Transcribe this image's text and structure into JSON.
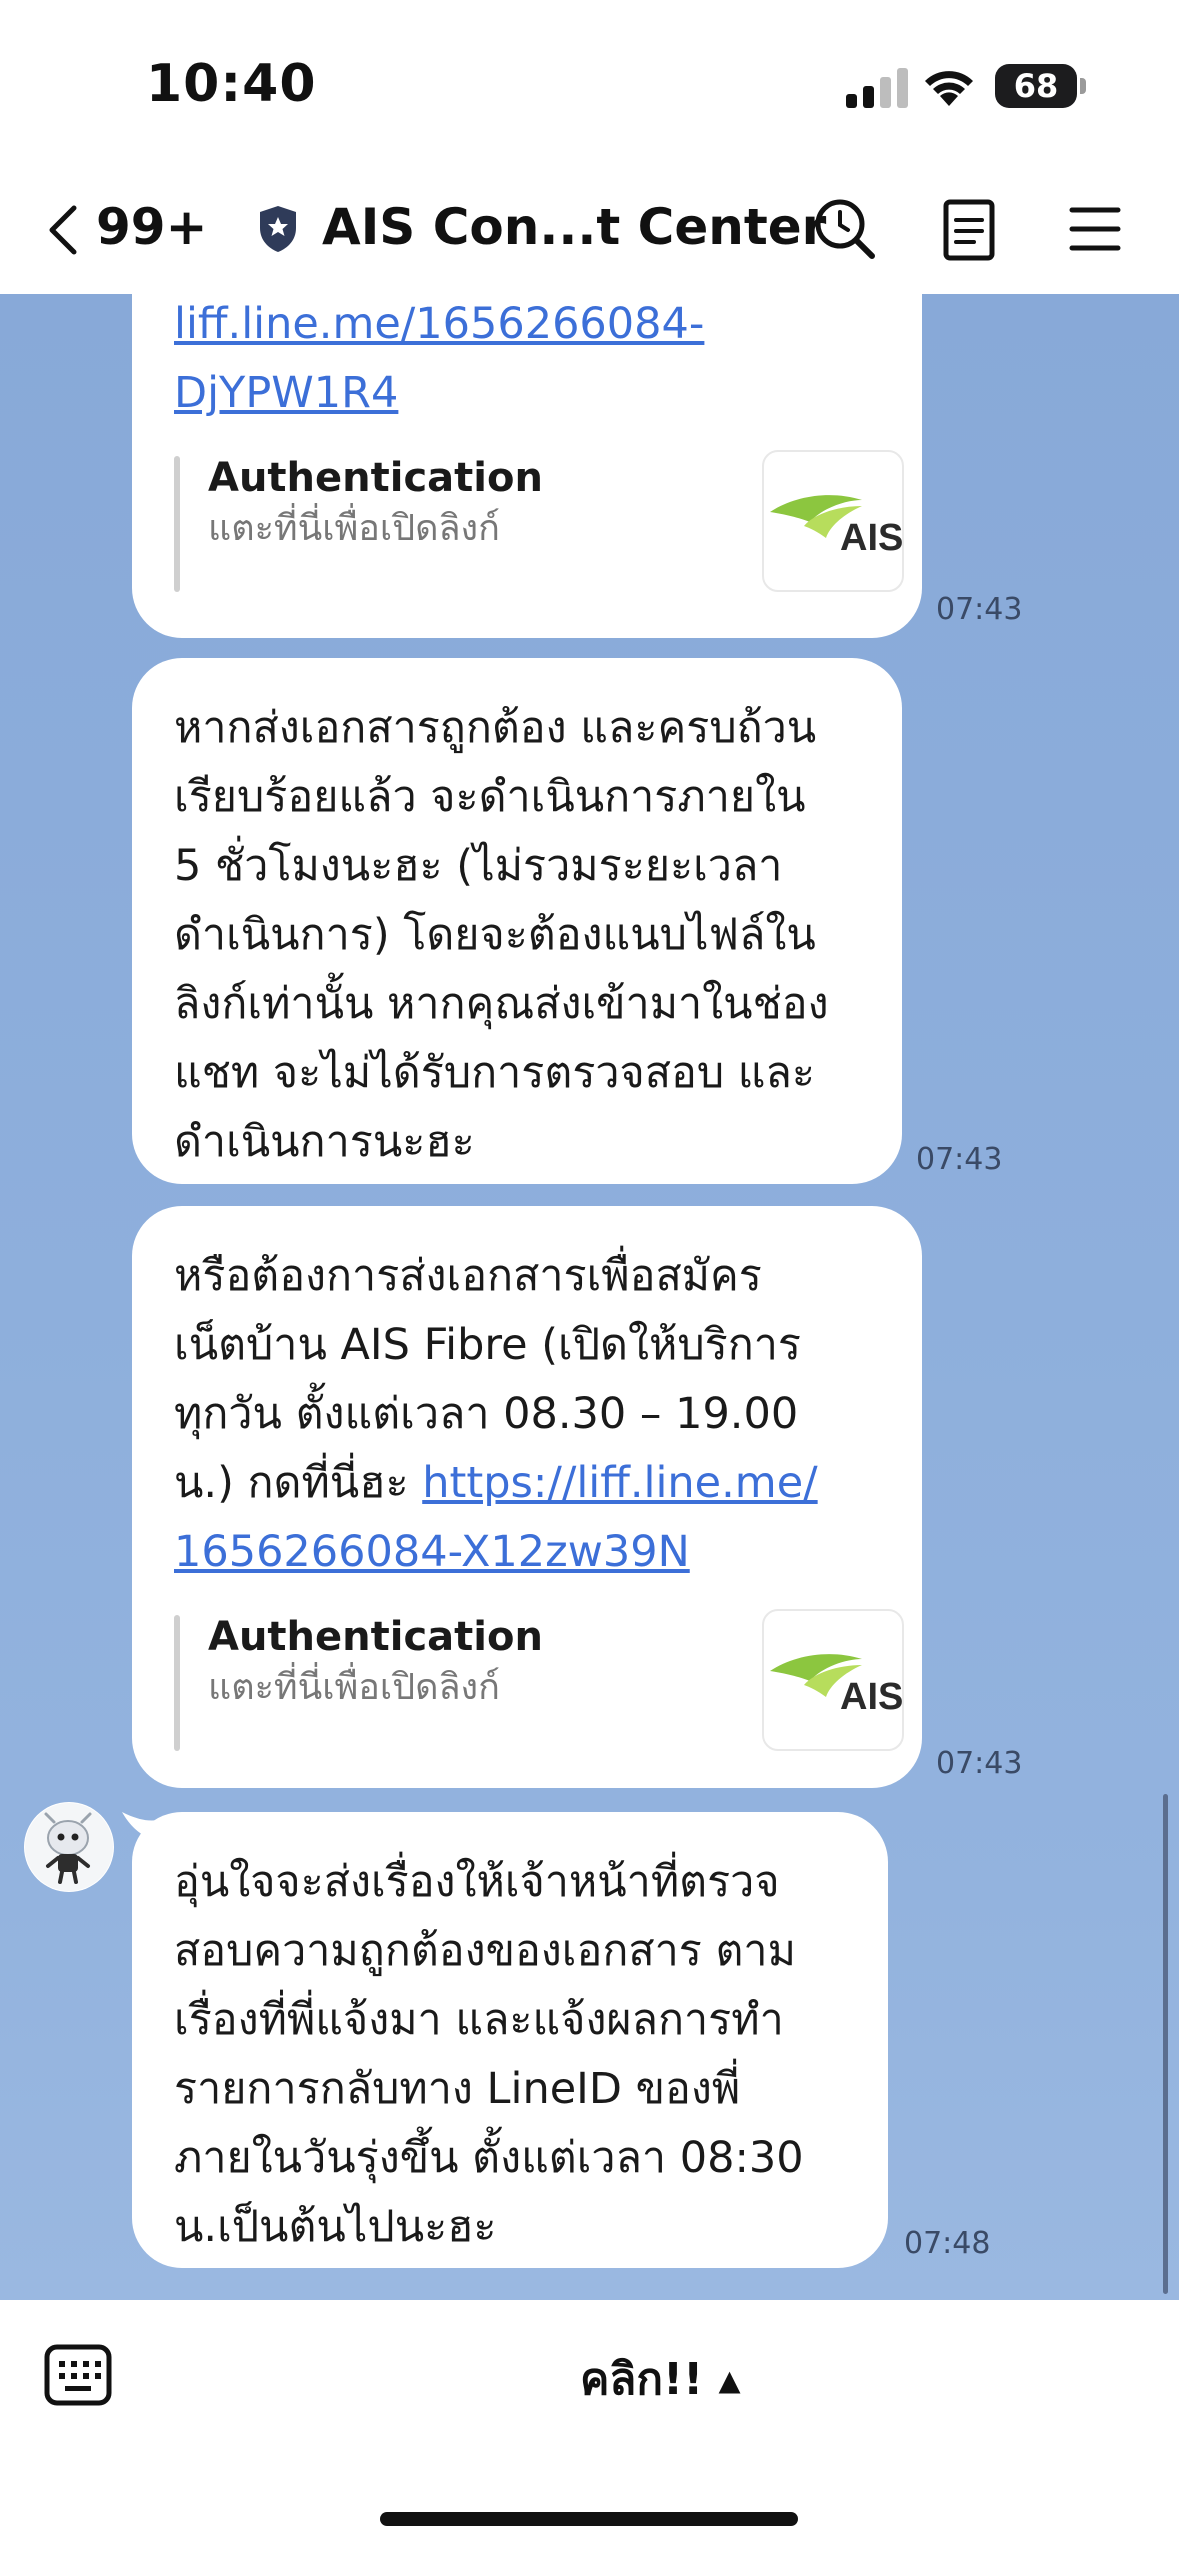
{
  "status_bar": {
    "time": "10:40",
    "battery": "68"
  },
  "header": {
    "unread_count": "99+",
    "title": "AIS Con...t Center"
  },
  "messages": [
    {
      "link_text": "liff.line.me/1656266084-\nDjYPW1R4",
      "preview": {
        "title": "Authentication",
        "subtitle": "แตะที่นี่เพื่อเปิดลิงก์"
      },
      "time": "07:43"
    },
    {
      "text": "หากส่งเอกสารถูกต้อง และครบถ้วน\nเรียบร้อยแล้ว จะดำเนินการภายใน\n5 ชั่วโมงนะฮะ (ไม่รวมระยะเวลา\nดำเนินการ) โดยจะต้องแนบไฟล์ใน\nลิงก์เท่านั้น หากคุณส่งเข้ามาในช่อง\nแชท จะไม่ได้รับการตรวจสอบ และ\nดำเนินการนะฮะ",
      "time": "07:43"
    },
    {
      "text": "หรือต้องการส่งเอกสารเพื่อสมัคร\nเน็ตบ้าน AIS Fibre (เปิดให้บริการ\nทุกวัน ตั้งแต่เวลา 08.30 – 19.00\nน.) กดที่นี่ฮะ ",
      "link_text": "https://liff.line.me/\n1656266084-X12zw39N",
      "preview": {
        "title": "Authentication",
        "subtitle": "แตะที่นี่เพื่อเปิดลิงก์"
      },
      "time": "07:43"
    },
    {
      "text": "อุ่นใจจะส่งเรื่องให้เจ้าหน้าที่ตรวจ\nสอบความถูกต้องของเอกสาร ตาม\nเรื่องที่พี่แจ้งมา และแจ้งผลการทำ\nรายการกลับทาง LineID ของพี่\nภายในวันรุ่งขึ้น ตั้งแต่เวลา 08:30\nน.เป็นต้นไปนะฮะ",
      "time": "07:48"
    }
  ],
  "logo_text": "AIS",
  "bottom_bar": {
    "rich_menu_label": "คลิก!! ▴"
  },
  "colors": {
    "chat_bg": "#8eafdc",
    "link": "#3c6fd8",
    "ais_green": "#8cc63f"
  }
}
